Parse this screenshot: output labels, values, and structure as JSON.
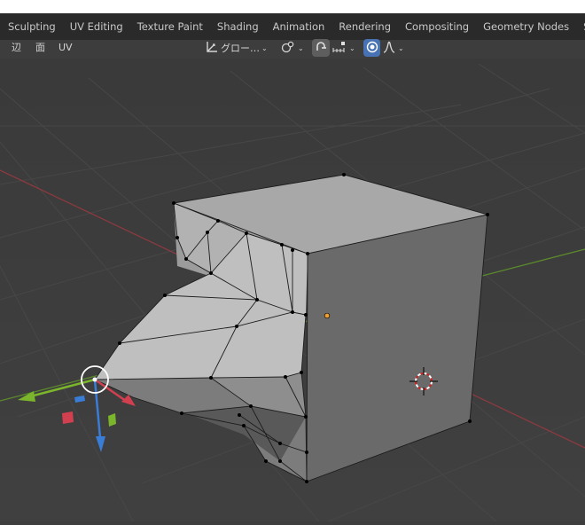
{
  "workspace_tabs": [
    "Sculpting",
    "UV Editing",
    "Texture Paint",
    "Shading",
    "Animation",
    "Rendering",
    "Compositing",
    "Geometry Nodes",
    "Scripting"
  ],
  "header": {
    "menus": [
      "辺",
      "面",
      "UV"
    ],
    "transform_orientation": "グロー…",
    "accent": "#4772b3"
  },
  "icons": [
    "transform-orientation-icon",
    "pivot-point-icon",
    "snap-icon",
    "snap-increment-icon",
    "proportional-editing-icon",
    "falloff-curve-icon",
    "3d-cursor-icon",
    "move-gizmo-icon"
  ]
}
